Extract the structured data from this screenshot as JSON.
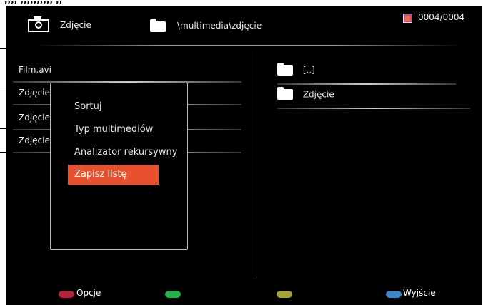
{
  "header": {
    "title": "Zdjęcie",
    "path": "\\multimedia\\zdjęcie",
    "counter": "0004/0004",
    "icons": {
      "camera": "camera-icon",
      "folder": "folder-icon",
      "counter": "media-file-icon"
    }
  },
  "left_list": {
    "items": [
      {
        "label": "Film.avi"
      },
      {
        "label": "Zdjęcie"
      },
      {
        "label": "Zdjęcie"
      },
      {
        "label": "Zdjęcie"
      }
    ]
  },
  "right_list": {
    "items": [
      {
        "label": "[..]",
        "icon": "folder-icon"
      },
      {
        "label": "Zdjęcie",
        "icon": "folder-icon"
      }
    ]
  },
  "context_menu": {
    "items": [
      {
        "label": "Sortuj"
      },
      {
        "label": "Typ multimediów"
      },
      {
        "label": "Analizator rekursywny"
      },
      {
        "label": "Zapisz listę",
        "selected": true
      }
    ]
  },
  "footer": {
    "red": {
      "label": "Opcje",
      "color": "#b5213a"
    },
    "green": {
      "label": "",
      "color": "#23b14a"
    },
    "yellow": {
      "label": "",
      "color": "#a6a23a"
    },
    "blue": {
      "label": "Wyjście",
      "color": "#3e86c7"
    }
  }
}
